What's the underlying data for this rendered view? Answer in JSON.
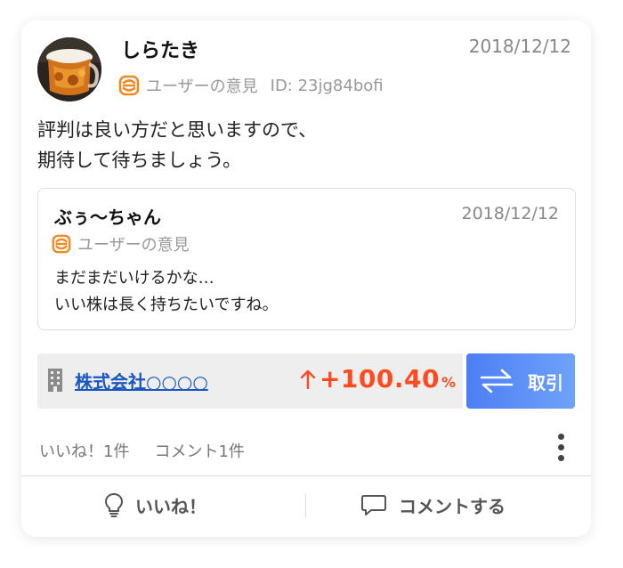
{
  "post": {
    "user_name": "しらたき",
    "date": "2018/12/12",
    "category": "ユーザーの意見",
    "id_text": "ID: 23jg84bofi",
    "body_lines": [
      "評判は良い方だと思いますので、",
      "期待して待ちましょう。"
    ]
  },
  "quote": {
    "user_name": "ぶぅ〜ちゃん",
    "date": "2018/12/12",
    "category": "ユーザーの意見",
    "body_lines": [
      "まだまだいけるかな…",
      "いい株は長く持ちたいですね。"
    ]
  },
  "stock": {
    "company": "株式会社○○○○",
    "change_value": "+100.40",
    "change_unit": "%",
    "change_color": "#ff4a1f",
    "trade_label": "取引"
  },
  "counts": {
    "likes": "いいね！1件",
    "comments": "コメント1件"
  },
  "actions": {
    "like_label": "いいね！",
    "comment_label": "コメントする"
  },
  "colors": {
    "accent_orange": "#f08a24",
    "link_blue": "#1a56c2",
    "button_blue": "#4d7ef5"
  },
  "icons": {
    "category": "user-opinion-icon",
    "company": "building-icon",
    "change": "arrow-up-icon",
    "trade": "swap-arrows-icon",
    "more": "more-vertical-icon",
    "like": "lightbulb-icon",
    "comment": "speech-bubble-icon"
  }
}
